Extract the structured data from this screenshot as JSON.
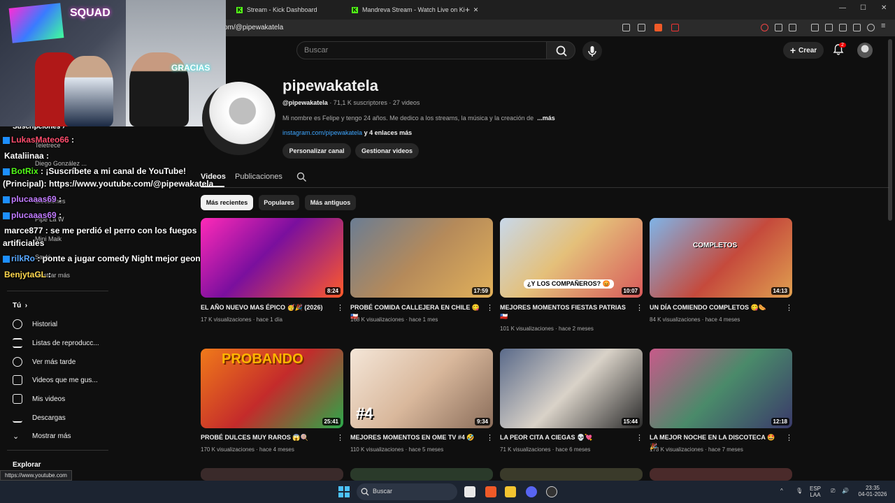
{
  "browser": {
    "tabs": [
      {
        "label": "Stream - Kick Dashboard"
      },
      {
        "label": "Mandreva Stream - Watch Live on Ki"
      }
    ],
    "new_tab": "+",
    "url": "om/@pipewakatela",
    "window": {
      "minimize": "—",
      "maximize": "☐",
      "close": "✕"
    }
  },
  "header": {
    "search_placeholder": "Buscar",
    "create_label": "Crear",
    "notification_count": "2"
  },
  "webcam": {
    "neon_text": "SQUAD",
    "sign_text": "GRACIAS"
  },
  "sidebar": {
    "subs_header": "Suscripciones",
    "subs_header_arrow": "›",
    "subs": [
      {
        "label": "Teletrece"
      },
      {
        "label": "Diego González ..."
      },
      {
        "label": "Elecciones"
      },
      {
        "label": "Pipe La W"
      },
      {
        "label": "Mini Maik"
      },
      {
        "label": "Sayki"
      },
      {
        "label": "Mostrar más"
      }
    ],
    "you_header": "Tú",
    "you_arrow": "›",
    "items": [
      {
        "label": "Historial",
        "icon": "history-icon"
      },
      {
        "label": "Listas de reproducc...",
        "icon": "playlist-icon"
      },
      {
        "label": "Ver más tarde",
        "icon": "clock-icon"
      },
      {
        "label": "Videos que me gus...",
        "icon": "thumb-up-icon"
      },
      {
        "label": "Mis videos",
        "icon": "my-videos-icon"
      },
      {
        "label": "Descargas",
        "icon": "download-icon"
      },
      {
        "label": "Mostrar más",
        "icon": "chevron-down-icon"
      }
    ],
    "explore_header": "Explorar"
  },
  "chat": [
    {
      "user": "LukasMateo66",
      "text": " :",
      "color": "#ff4d6d"
    },
    {
      "user": "Kataliinaa",
      "text": " :",
      "color": "#ffffff"
    },
    {
      "user": "BotRix",
      "text": " : ¡Suscríbete a mi canal de YouTube!",
      "color": "#53fc18"
    },
    {
      "user": "",
      "text": "(Principal): https://www.youtube.com/@pipewakatela",
      "color": "#ffffff"
    },
    {
      "user": "plucaaas69",
      "text": " :",
      "color": "#c17bff"
    },
    {
      "user": "plucaaas69",
      "text": " :",
      "color": "#c17bff"
    },
    {
      "user": "marce877",
      "text": " : se me perdió el perro con los fuegos",
      "color": "#ffffff"
    },
    {
      "user": "",
      "text": "artificiales",
      "color": "#ffffff"
    },
    {
      "user": "rilkRo",
      "text": " : ponte a jugar comedy Night mejor geon",
      "color": "#5aa9ff"
    },
    {
      "user": "BenjytaGL",
      "text": " :",
      "color": "#ffd84d"
    }
  ],
  "channel": {
    "name": "pipewakatela",
    "handle": "@pipewakatela",
    "stats": " · 71,1 K suscriptores · 27 videos",
    "description": "Mi nombre es Felipe y tengo 24 años. Me dedico a los streams, la música y la creación de",
    "more": "...más",
    "link": "instagram.com/pipewakatela",
    "more_links": " y 4 enlaces más",
    "buttons": [
      "Personalizar canal",
      "Gestionar videos"
    ],
    "tabs": [
      "Videos",
      "Publicaciones"
    ],
    "chips": [
      "Más recientes",
      "Populares",
      "Más antiguos"
    ]
  },
  "videos": [
    {
      "title": "EL AÑO NUEVO MAS ÉPICO 🥳🎉 (2026)",
      "meta": "17 K visualizaciones · hace 1 día",
      "duration": "8:24",
      "bg": "linear-gradient(135deg,#ff2ab8,#7a0f9e 45%,#ff5a2a)"
    },
    {
      "title": "PROBÉ COMIDA CALLEJERA EN CHILE 😋🇨🇱",
      "meta": "168 K visualizaciones · hace 1 mes",
      "duration": "17:59",
      "bg": "linear-gradient(135deg,#6b7d93,#b58a5a 50%,#e2b15a)"
    },
    {
      "title": "MEJORES MOMENTOS FIESTAS PATRIAS 🇨🇱",
      "meta": "101 K visualizaciones · hace 2 meses",
      "duration": "10:07",
      "bg": "linear-gradient(135deg,#c8d8ea,#e4c07a 45%,#d85a5a)",
      "overlay": "¿Y LOS COMPAÑEROS? 😡"
    },
    {
      "title": "UN DÍA COMIENDO COMPLETOS 😋🌭",
      "meta": "84 K visualizaciones · hace 4 meses",
      "duration": "14:13",
      "bg": "linear-gradient(135deg,#7fb4e8,#c54a3c 55%,#e0a050)",
      "overlay": "COMPLETOS"
    },
    {
      "title": "PROBÉ DULCES MUY RAROS 😱🍭",
      "meta": "170 K visualizaciones · hace 4 meses",
      "duration": "25:41",
      "bg": "linear-gradient(135deg,#f07a1a,#c42b2b 50%,#2ba84a)",
      "overlay": "PROBANDO"
    },
    {
      "title": "MEJORES MOMENTOS EN OME TV #4 🤣",
      "meta": "110 K visualizaciones · hace 5 meses",
      "duration": "9:34",
      "bg": "linear-gradient(135deg,#f4e6d8,#d9b89c 50%,#8a6d5a)",
      "overlay": "#4"
    },
    {
      "title": "LA PEOR CITA A CIEGAS 💀💘",
      "meta": "71 K visualizaciones · hace 6 meses",
      "duration": "15:44",
      "bg": "linear-gradient(135deg,#5a6a8a,#d9d2c8 50%,#2a2a2a)"
    },
    {
      "title": "LA MEJOR NOCHE EN LA DISCOTECA 🤩🎉",
      "meta": "173 K visualizaciones · hace 7 meses",
      "duration": "12:18",
      "bg": "linear-gradient(135deg,#c85a8a,#4a8a6a 50%,#3a3a6a)"
    }
  ],
  "status_url": "https://www.youtube.com",
  "taskbar": {
    "search": "Buscar",
    "lang": "ESP",
    "lang2": "LAA",
    "time": "23:35",
    "date": "04-01-2026"
  }
}
